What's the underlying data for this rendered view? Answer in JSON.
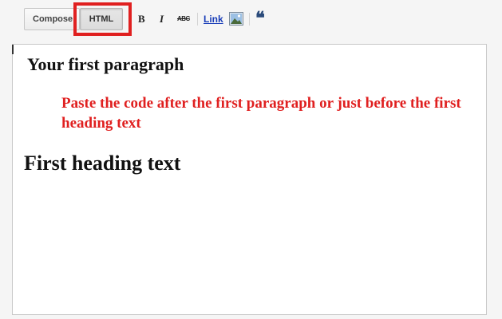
{
  "toolbar": {
    "compose_label": "Compose",
    "html_label": "HTML",
    "bold_label": "B",
    "italic_label": "I",
    "strike_label": "ABC",
    "link_label": "Link",
    "quote_label": "❝",
    "image_icon": "image-icon",
    "highlight_color": "#e02020"
  },
  "editor": {
    "paragraph": "Your first paragraph",
    "note": "Paste the code after the first paragraph or just before the first heading text",
    "heading": "First heading text",
    "note_color": "#e02020"
  }
}
